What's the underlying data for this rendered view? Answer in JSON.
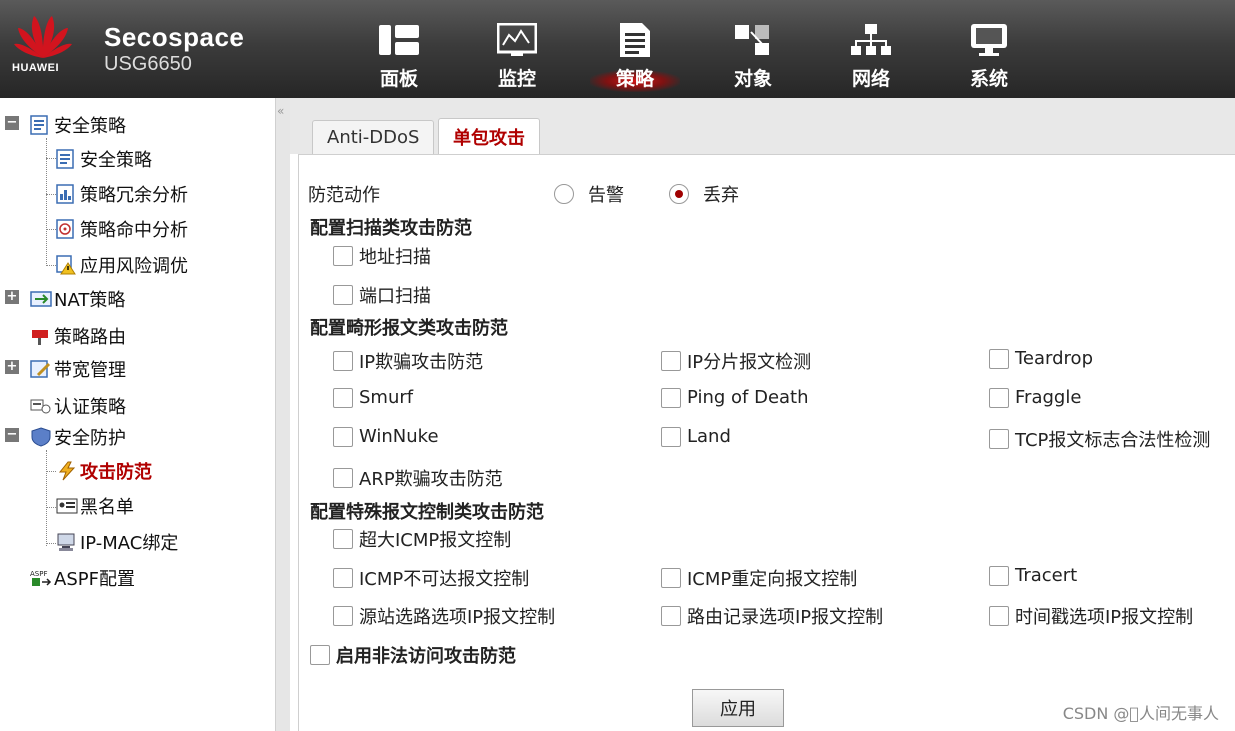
{
  "header": {
    "brand": "HUAWEI",
    "product_name": "Secospace",
    "product_model": "USG6650",
    "nav": [
      {
        "label": "面板",
        "icon": "dashboard-icon",
        "active": false
      },
      {
        "label": "监控",
        "icon": "monitor-icon",
        "active": false
      },
      {
        "label": "策略",
        "icon": "policy-document-icon",
        "active": true
      },
      {
        "label": "对象",
        "icon": "objects-icon",
        "active": false
      },
      {
        "label": "网络",
        "icon": "network-icon",
        "active": false
      },
      {
        "label": "系统",
        "icon": "system-icon",
        "active": false
      }
    ]
  },
  "sidebar": {
    "security_policy": "安全策略",
    "security_policy_child": "安全策略",
    "policy_redundancy": "策略冗余分析",
    "policy_hit": "策略命中分析",
    "app_risk": "应用风险调优",
    "nat_policy": "NAT策略",
    "policy_route": "策略路由",
    "bandwidth": "带宽管理",
    "auth_policy": "认证策略",
    "security_protection": "安全防护",
    "attack_defense": "攻击防范",
    "blacklist": "黑名单",
    "ip_mac": "IP-MAC绑定",
    "aspf": "ASPF配置"
  },
  "tabs": [
    {
      "label": "Anti-DDoS",
      "active": false
    },
    {
      "label": "单包攻击",
      "active": true
    }
  ],
  "form": {
    "action_label": "防范动作",
    "action_options": [
      {
        "label": "告警",
        "checked": false
      },
      {
        "label": "丢弃",
        "checked": true
      }
    ],
    "scan_title": "配置扫描类攻击防范",
    "scan_items": [
      "地址扫描",
      "端口扫描"
    ],
    "malformed_title": "配置畸形报文类攻击防范",
    "malformed_items": [
      "IP欺骗攻击防范",
      "IP分片报文检测",
      "Teardrop",
      "Smurf",
      "Ping of Death",
      "Fraggle",
      "WinNuke",
      "Land",
      "TCP报文标志合法性检测",
      "ARP欺骗攻击防范"
    ],
    "special_title": "配置特殊报文控制类攻击防范",
    "special_items": [
      "超大ICMP报文控制",
      "ICMP不可达报文控制",
      "ICMP重定向报文控制",
      "Tracert",
      "源站选路选项IP报文控制",
      "路由记录选项IP报文控制",
      "时间戳选项IP报文控制"
    ],
    "illegal_access": "启用非法访问攻击防范",
    "apply_label": "应用"
  },
  "watermark": "CSDN @\u0000人间无事人",
  "colors": {
    "accent": "#b00000",
    "header_bg": "#3c3c3c"
  }
}
